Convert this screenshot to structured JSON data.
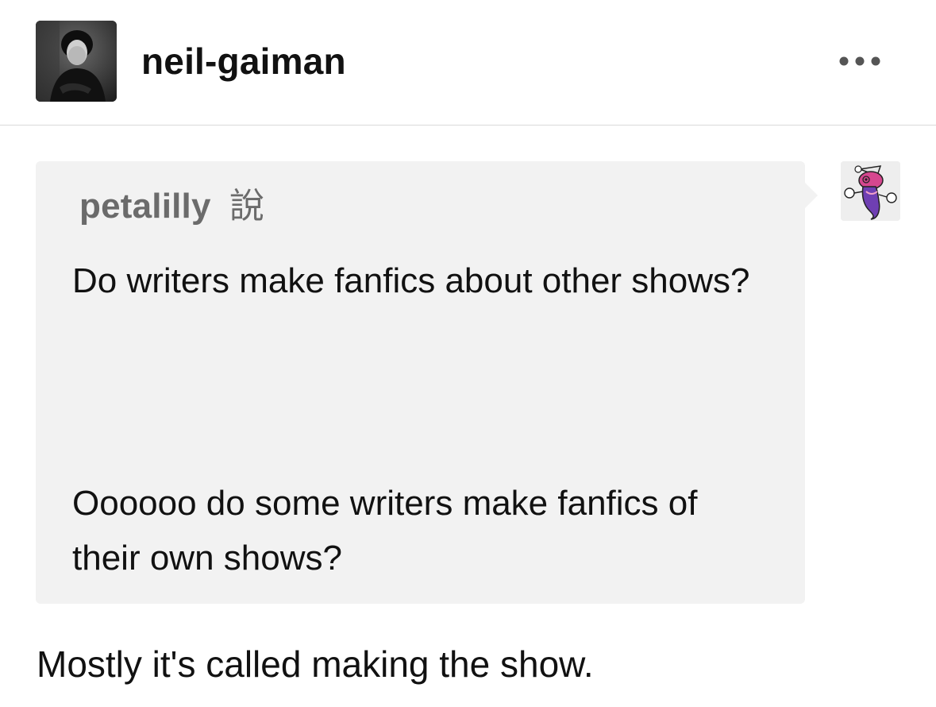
{
  "post": {
    "blog_name": "neil-gaiman",
    "avatar_icon": "author-portrait-avatar",
    "more_icon": "more-options-icon"
  },
  "ask": {
    "asker_name": "petalilly",
    "said_label": "說",
    "asker_avatar_icon": "cartoon-character-avatar",
    "question_paragraph_1": "Do writers make fanfics about other shows?",
    "question_paragraph_2": "Oooooo do some writers make fanfics of their own shows?"
  },
  "answer": {
    "text": "Mostly it's called making the show."
  },
  "colors": {
    "ask_background": "#f2f2f2",
    "asker_name": "#6b6b6b",
    "divider": "#d9d9d9",
    "text": "#111111"
  }
}
